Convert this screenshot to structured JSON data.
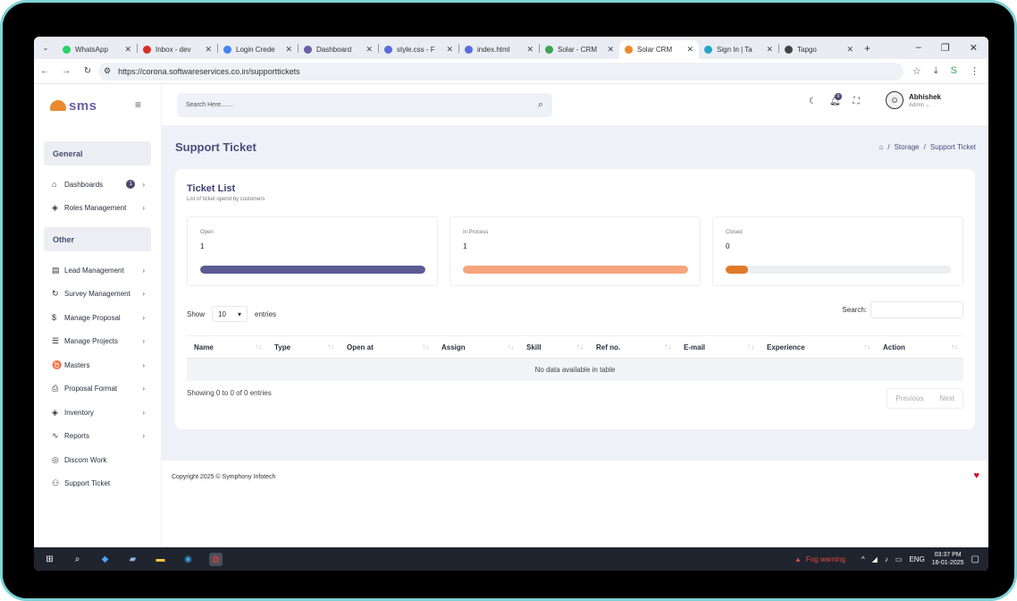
{
  "browser": {
    "tabs": [
      {
        "title": "WhatsApp",
        "color": "#25d366"
      },
      {
        "title": "Inbox - dev",
        "color": "#d93025"
      },
      {
        "title": "Login Crede",
        "color": "#4285f4"
      },
      {
        "title": "Dashboard",
        "color": "#6b5fa8"
      },
      {
        "title": "style.css - F",
        "color": "#5b6bd8"
      },
      {
        "title": "index.html",
        "color": "#5b6bd8"
      },
      {
        "title": "Solar - CRM",
        "color": "#3aa655"
      },
      {
        "title": "Solar CRM",
        "color": "#e88b2f"
      },
      {
        "title": "Sign In | Ta",
        "color": "#2aa4c9"
      },
      {
        "title": "Tapgo",
        "color": "#444444"
      }
    ],
    "url": "https://corona.softwareservices.co.in/supporttickets"
  },
  "sidebar": {
    "logo_text": "sms",
    "section_general": "General",
    "section_other": "Other",
    "dashboards": "Dashboards",
    "dashboards_badge": "1",
    "roles": "Roles Management",
    "lead": "Lead Management",
    "survey": "Survey Management",
    "proposal": "Manage Proposal",
    "projects": "Manage Projects",
    "masters": "Masters",
    "proposal_format": "Proposal Format",
    "inventory": "Inventory",
    "reports": "Reports",
    "discom": "Discom Work",
    "support": "Support Ticket"
  },
  "header": {
    "search_placeholder": "Search Here.......",
    "bell_count": "0",
    "user_name": "Abhishek",
    "user_role": "Admin ⌄"
  },
  "page": {
    "title": "Support Ticket",
    "crumb_storage": "Storage",
    "crumb_current": "Support Ticket"
  },
  "ticket_list": {
    "title": "Ticket List",
    "subtitle": "List of ticket opend by customers",
    "stats": [
      {
        "label": "Open",
        "value": "1",
        "progress": 1.0,
        "color": "#5b5a94"
      },
      {
        "label": "In Process",
        "value": "1",
        "progress": 1.0,
        "color": "#f6a57e"
      },
      {
        "label": "Closed",
        "value": "0",
        "progress": 0.1,
        "color": "#e07a2a"
      }
    ],
    "show_label": "Show",
    "entries_value": "10",
    "entries_label": "entries",
    "search_label": "Search:",
    "columns": [
      "Name",
      "Type",
      "Open at",
      "Assign",
      "Skill",
      "Ref no.",
      "E-mail",
      "Experience",
      "Action"
    ],
    "empty_text": "No data available in table",
    "info": "Showing 0 to 0 of 0 entries",
    "prev": "Previous",
    "next": "Next"
  },
  "footer": {
    "copyright": "Copyright 2025 © Symphony Infotech"
  },
  "taskbar": {
    "weather": "Fog warning",
    "lang": "ENG",
    "time": "03:37 PM",
    "date": "16-01-2025"
  }
}
